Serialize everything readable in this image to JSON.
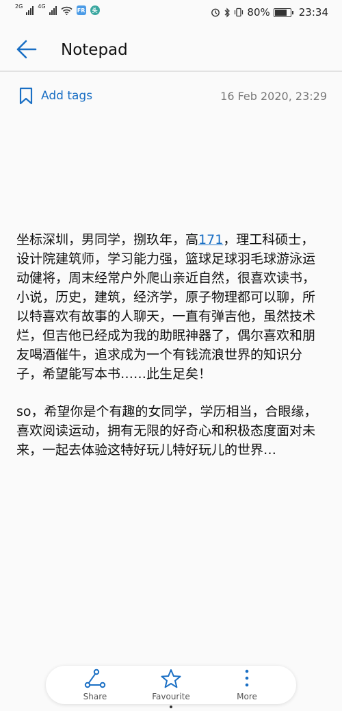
{
  "status_bar": {
    "network_1": "2G",
    "network_2": "4G",
    "app_badge_1": "FR",
    "app_badge_2": "头",
    "battery_percent": "80%",
    "time": "23:34",
    "battery_level": 0.8
  },
  "header": {
    "title": "Notepad",
    "back_icon": "arrow-left-icon"
  },
  "meta": {
    "tags_label": "Add tags",
    "tags_icon": "bookmark-icon",
    "timestamp": "16 Feb 2020, 23:29"
  },
  "note": {
    "p1_before": "坐标深圳，男同学，捌玖年，高",
    "p1_link": "171",
    "p1_after": "，理工科硕士，设计院建筑师，学习能力强，篮球足球羽毛球游泳运动健将，周末经常户外爬山亲近自然，很喜欢读书，小说，历史，建筑，经济学，原子物理都可以聊，所以特喜欢有故事的人聊天，一直有弹吉他，虽然技术烂，但吉他已经成为我的助眠神器了，偶尔喜欢和朋友喝酒催牛，追求成为一个有钱流浪世界的知识分子，希望能写本书……此生足矣！",
    "p2": "so，希望你是个有趣的女同学，学历相当，合眼缘，喜欢阅读运动，拥有无限的好奇心和积极态度面对未来，一起去体验这特好玩儿特好玩儿的世界…"
  },
  "actions": [
    {
      "label": "Share",
      "icon": "share-icon"
    },
    {
      "label": "Favourite",
      "icon": "star-icon"
    },
    {
      "label": "More",
      "icon": "more-vertical-icon"
    }
  ],
  "colors": {
    "accent": "#1a6fc4",
    "background": "#fafafa"
  }
}
